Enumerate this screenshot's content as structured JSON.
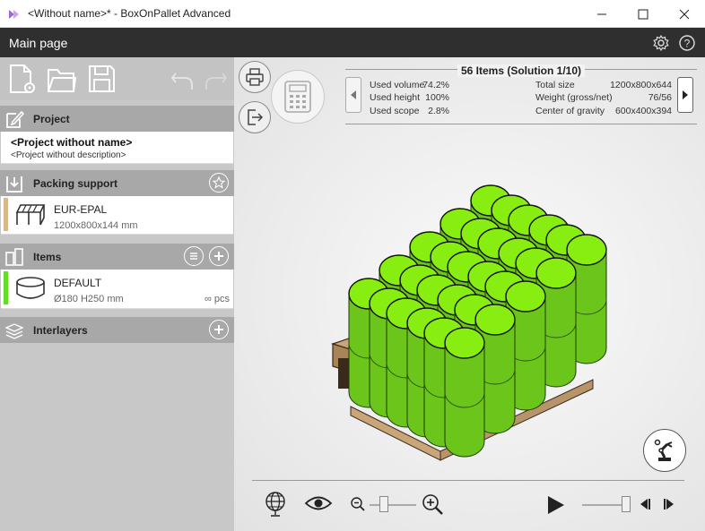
{
  "window": {
    "title": "<Without name>* - BoxOnPallet Advanced",
    "app_icon": "boxonpallet-logo-icon",
    "controls": [
      "minimize-icon",
      "maximize-icon",
      "close-icon"
    ]
  },
  "header": {
    "title": "Main page",
    "icons": [
      "gear-icon",
      "help-icon"
    ]
  },
  "toolbar": {
    "icons": [
      "new-project-icon",
      "open-folder-icon",
      "save-icon",
      "undo-icon",
      "redo-icon"
    ]
  },
  "project": {
    "section_label": "Project",
    "name": "<Project without name>",
    "description": "<Project without description>"
  },
  "packing_support": {
    "section_label": "Packing support",
    "name": "EUR-EPAL",
    "size": "1200x800x144 mm",
    "accent_color": "#d9b88a"
  },
  "items": {
    "section_label": "Items",
    "name": "DEFAULT",
    "size": "Ø180 H250 mm",
    "quantity": "∞ pcs",
    "accent_color": "#66dd22"
  },
  "interlayers": {
    "section_label": "Interlayers"
  },
  "solution": {
    "title": "56 Items (Solution 1/10)",
    "stats_left": [
      {
        "label": "Used volume",
        "value": "74.2%"
      },
      {
        "label": "Used height",
        "value": "100%"
      },
      {
        "label": "Used scope",
        "value": "2.8%"
      }
    ],
    "stats_right": [
      {
        "label": "Total size",
        "value": "1200x800x644"
      },
      {
        "label": "Weight (gross/net)",
        "value": "76/56"
      },
      {
        "label": "Center of gravity",
        "value": "600x400x394"
      }
    ]
  },
  "scene": {
    "cylinder_color": "#88ee11",
    "pallet_color": "#c9a679"
  },
  "playback": {
    "zoom_level": 0.25,
    "timeline_position": 1.0
  }
}
